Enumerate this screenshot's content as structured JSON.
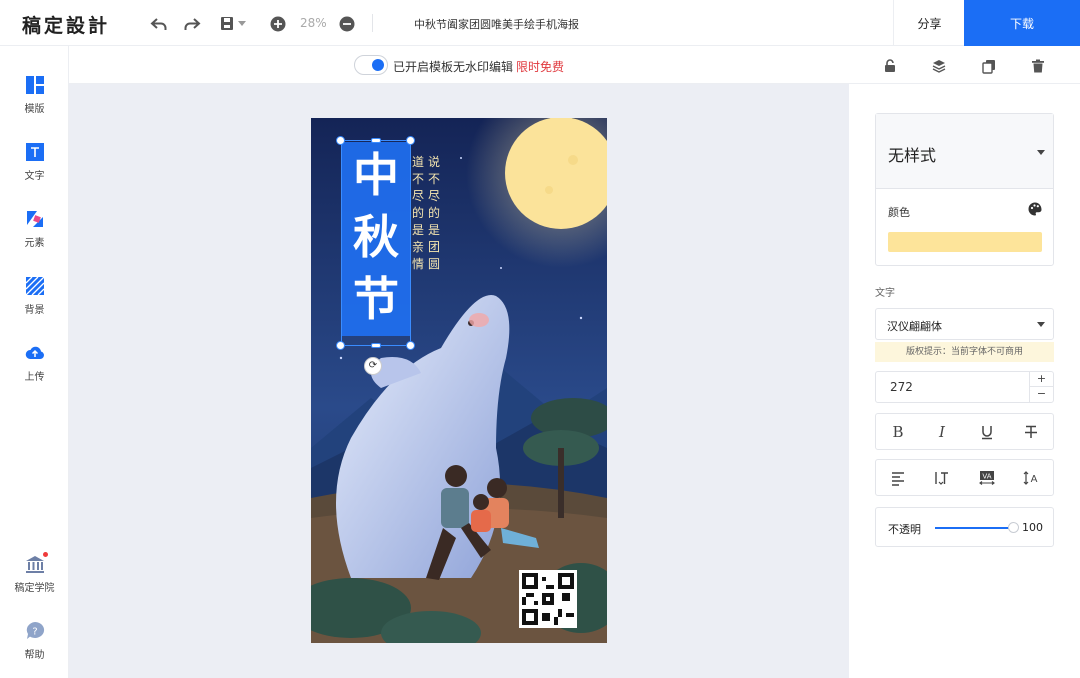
{
  "app": {
    "logo": "稿定設計",
    "zoom": "28%",
    "doc_title": "中秋节阖家团圆唯美手绘手机海报",
    "share_label": "分享",
    "download_label": "下载",
    "brand_color": "#1b6ef5"
  },
  "sidebar": {
    "items": [
      {
        "label": "模版",
        "icon": "template-icon"
      },
      {
        "label": "文字",
        "icon": "text-icon"
      },
      {
        "label": "元素",
        "icon": "elements-icon"
      },
      {
        "label": "背景",
        "icon": "background-icon"
      },
      {
        "label": "上传",
        "icon": "upload-icon"
      }
    ],
    "bottom_items": [
      {
        "label": "稿定学院",
        "icon": "academy-icon"
      },
      {
        "label": "帮助",
        "icon": "help-icon"
      }
    ]
  },
  "subbar": {
    "watermark_text": "已开启模板无水印编辑",
    "free_text": "限时免费",
    "toggle_on": true
  },
  "poster": {
    "title_chars": [
      "中",
      "秋",
      "节"
    ],
    "verse_col1": [
      "说",
      "不",
      "尽",
      "的",
      "是",
      "团",
      "圆"
    ],
    "verse_col2": [
      "道",
      "不",
      "尽",
      "的",
      "是",
      "亲",
      "情"
    ]
  },
  "panel": {
    "style_name": "无样式",
    "color_label": "颜色",
    "color_value": "#fde49a",
    "text_section": "文字",
    "font_name": "汉仪翩翩体",
    "copyright_tip": "版权提示：当前字体不可商用",
    "font_size": "272",
    "opacity_label": "不透明",
    "opacity_value": "100",
    "opacity_fraction": 1.0
  }
}
